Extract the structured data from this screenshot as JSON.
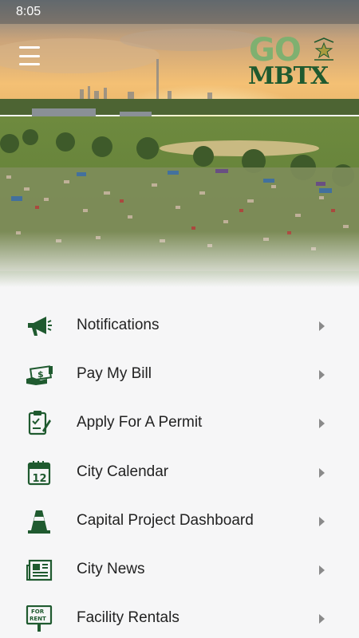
{
  "status_bar": {
    "time": "8:05"
  },
  "header": {
    "logo_top": "GO",
    "logo_bottom": "MBTX",
    "menu_icon": "hamburger-icon"
  },
  "menu": {
    "items": [
      {
        "label": "Notifications",
        "icon": "megaphone-icon"
      },
      {
        "label": "Pay My Bill",
        "icon": "money-hand-icon"
      },
      {
        "label": "Apply For A Permit",
        "icon": "permit-clipboard-icon"
      },
      {
        "label": "City Calendar",
        "icon": "calendar-icon",
        "icon_text": "12"
      },
      {
        "label": "Capital Project Dashboard",
        "icon": "traffic-cone-icon"
      },
      {
        "label": "City News",
        "icon": "newspaper-icon"
      },
      {
        "label": "Facility Rentals",
        "icon": "for-rent-sign-icon",
        "icon_text": "FOR RENT"
      }
    ]
  },
  "colors": {
    "icon_green": "#1f5a2f",
    "logo_light_green": "#7fb070",
    "background": "#f6f6f7",
    "text": "#222222",
    "chevron": "#8a8a8a"
  }
}
